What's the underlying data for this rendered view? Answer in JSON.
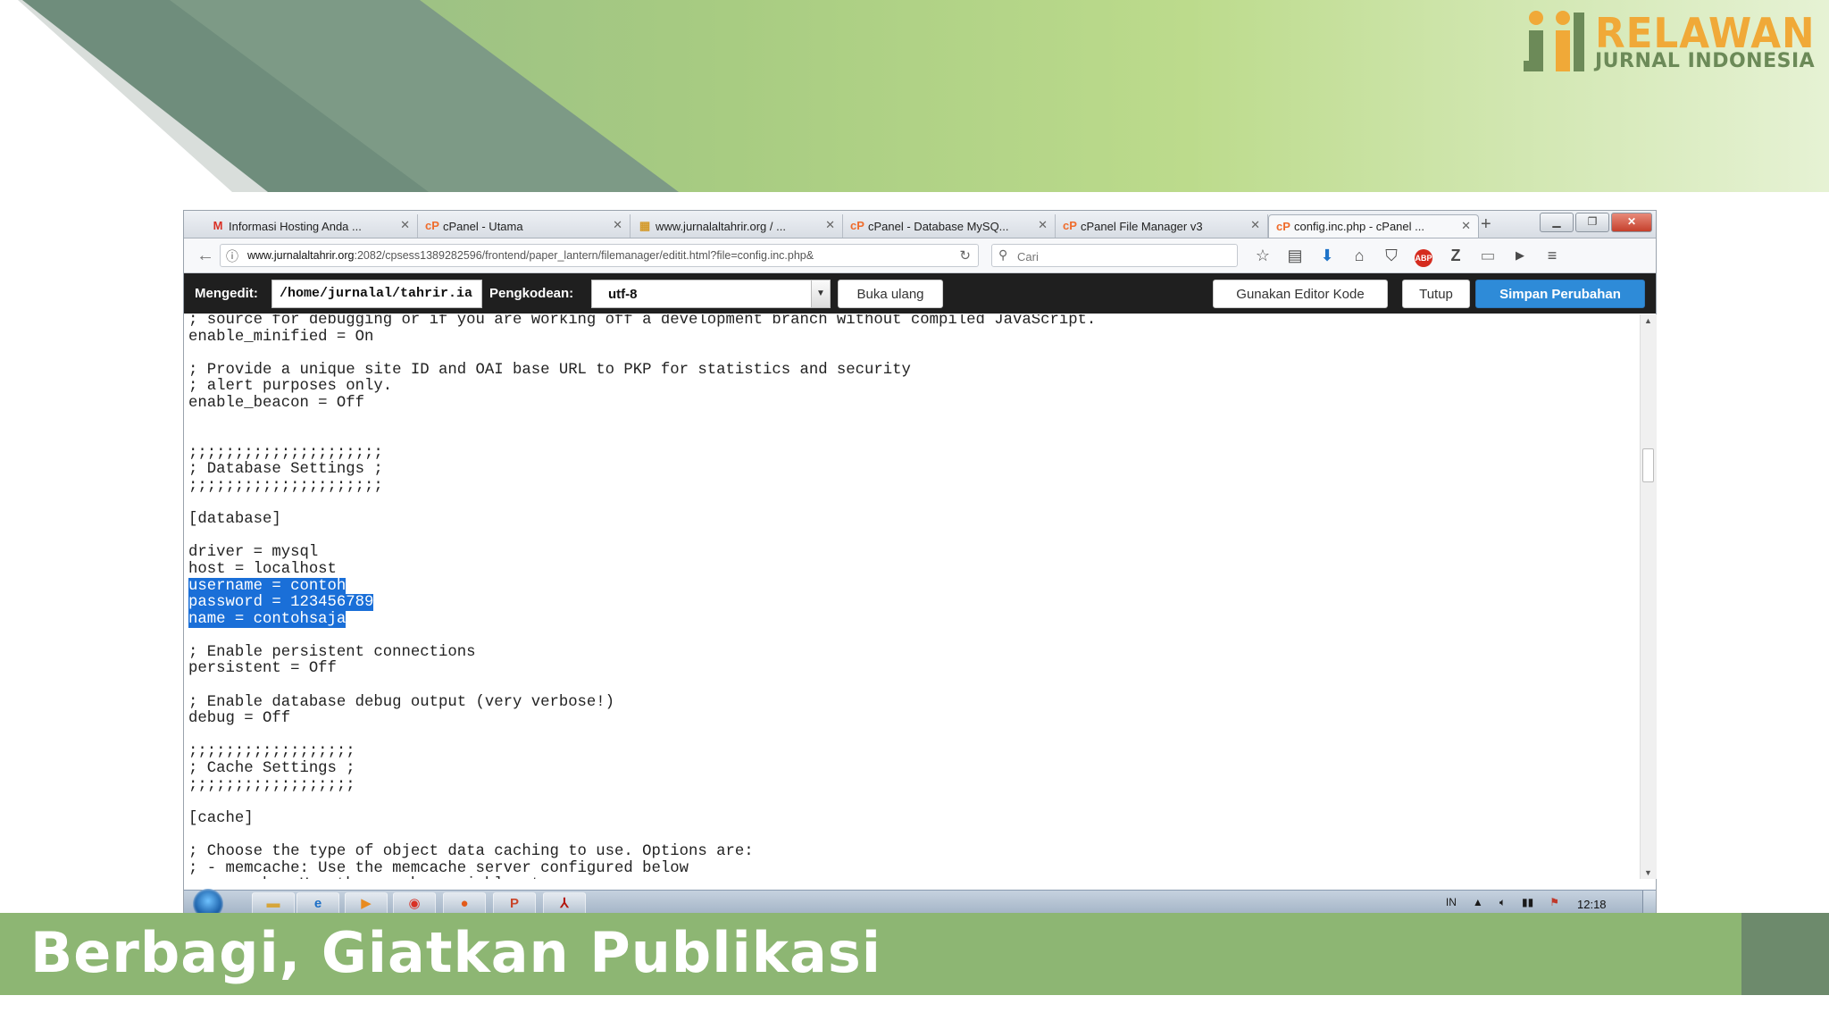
{
  "slide": {
    "logo_word1": "RELAWAN",
    "logo_word2": "JURNAL INDONESIA",
    "banner_text": "Berbagi, Giatkan Publikasi",
    "colors": {
      "banner_green": "#8db673",
      "logo_orange": "#f0a938",
      "accent_blue": "#2e8bd8",
      "selection_blue": "#1a6fd8"
    }
  },
  "browser": {
    "tabs": [
      {
        "label": "Informasi Hosting Anda ...",
        "icon": "gmail-icon"
      },
      {
        "label": "cPanel - Utama",
        "icon": "cpanel-icon"
      },
      {
        "label": "www.jurnalaltahrir.org / ...",
        "icon": "site-icon"
      },
      {
        "label": "cPanel - Database MySQ...",
        "icon": "cpanel-icon"
      },
      {
        "label": "cPanel File Manager v3",
        "icon": "cpanel-icon"
      },
      {
        "label": "config.inc.php - cPanel ...",
        "icon": "cpanel-icon",
        "active": true
      }
    ],
    "url_domain": "www.jurnalaltahrir.org",
    "url_rest": ":2082/cpsess1389282596/frontend/paper_lantern/filemanager/editit.html?file=config.inc.php&",
    "search_placeholder": "Cari"
  },
  "editor": {
    "editing_label": "Mengedit:",
    "path_value": "/home/jurnalal/tahrir.ia",
    "encoding_label": "Pengkodean:",
    "encoding_value": "utf-8",
    "reload_label": "Buka ulang",
    "code_editor_label": "Gunakan Editor Kode",
    "close_label": "Tutup",
    "save_label": "Simpan Perubahan",
    "lines": [
      "; source for debugging or if you are working off a development branch without compiled JavaScript.",
      "enable_minified = On",
      "",
      "; Provide a unique site ID and OAI base URL to PKP for statistics and security",
      "; alert purposes only.",
      "enable_beacon = Off",
      "",
      "",
      ";;;;;;;;;;;;;;;;;;;;;",
      "; Database Settings ;",
      ";;;;;;;;;;;;;;;;;;;;;",
      "",
      "[database]",
      "",
      "driver = mysql",
      "host = localhost",
      "username = contoh",
      "password = 123456789",
      "name = contohsaja",
      "",
      "; Enable persistent connections",
      "persistent = Off",
      "",
      "; Enable database debug output (very verbose!)",
      "debug = Off",
      "",
      ";;;;;;;;;;;;;;;;;;",
      "; Cache Settings ;",
      ";;;;;;;;;;;;;;;;;;",
      "",
      "[cache]",
      "",
      "; Choose the type of object data caching to use. Options are:",
      "; - memcache: Use the memcache server configured below",
      "; - xcache: Use the xcache variable store"
    ],
    "selected_lines": [
      16,
      17,
      18
    ]
  },
  "taskbar": {
    "language": "IN",
    "clock": "12:18"
  }
}
